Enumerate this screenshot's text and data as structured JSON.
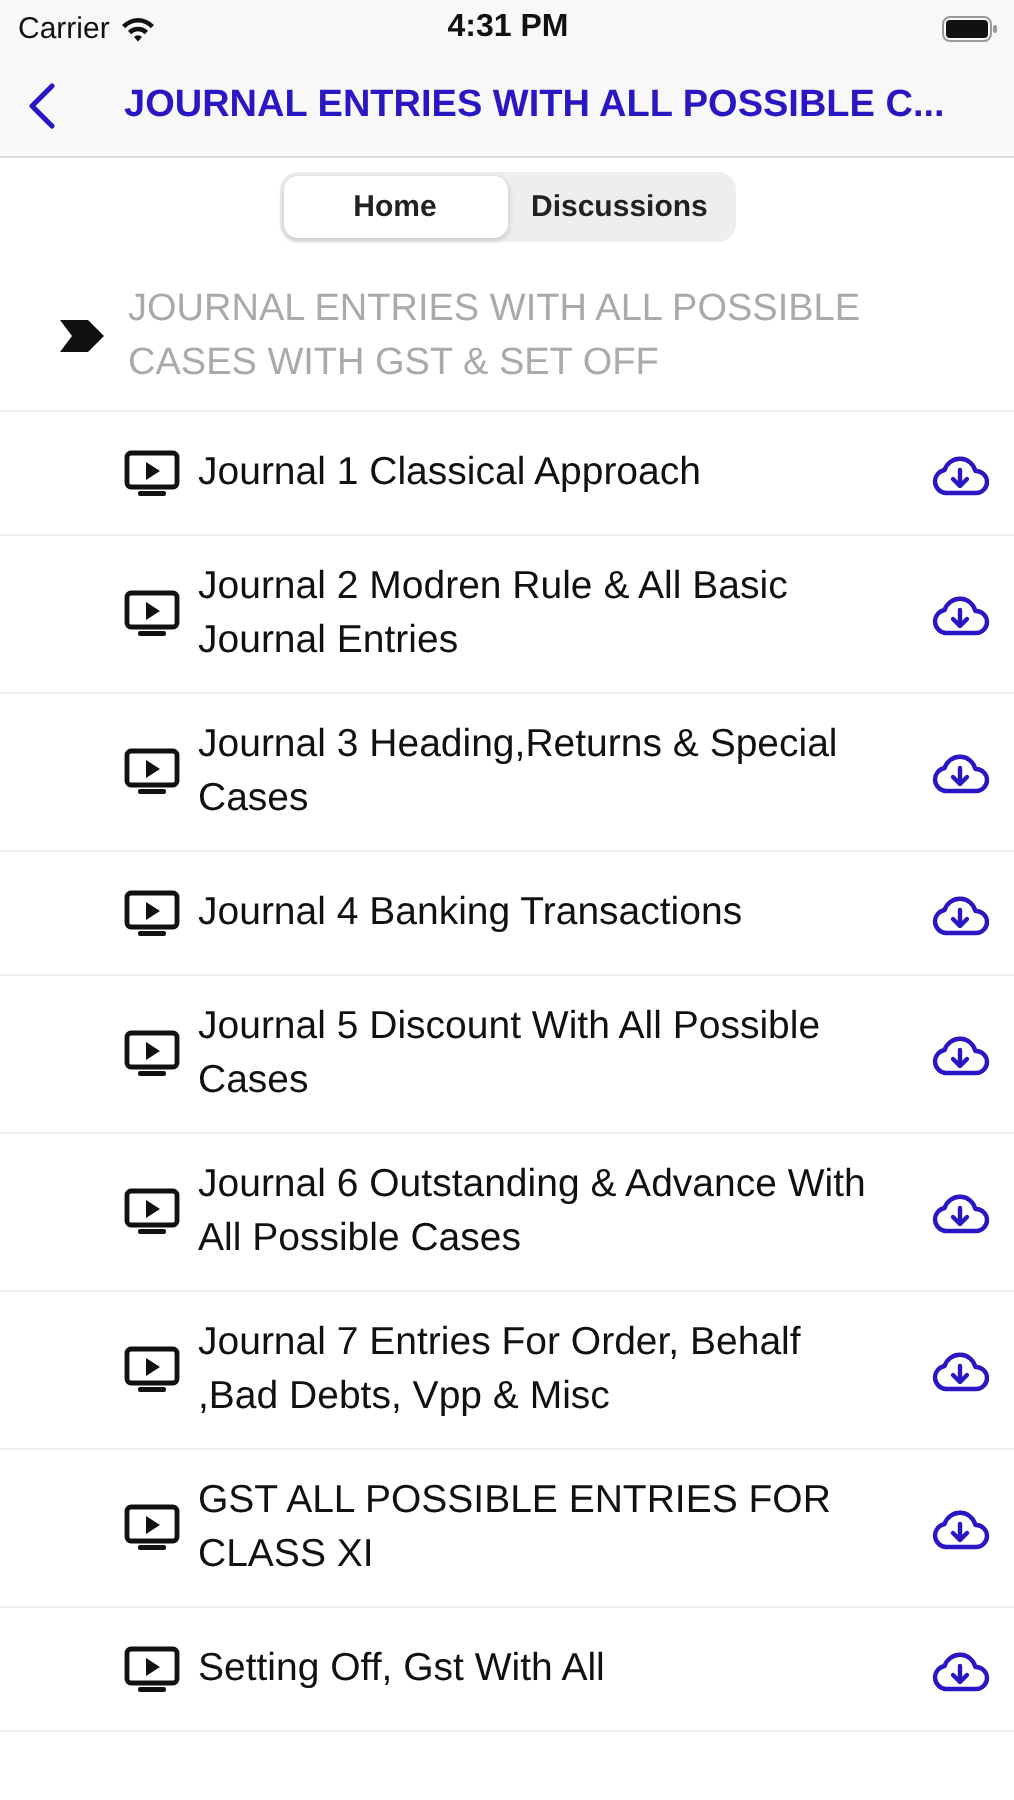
{
  "status_bar": {
    "carrier": "Carrier",
    "time": "4:31 PM"
  },
  "nav": {
    "title": "JOURNAL ENTRIES WITH ALL POSSIBLE C..."
  },
  "segments": [
    {
      "label": "Home",
      "selected": true
    },
    {
      "label": "Discussions",
      "selected": false
    }
  ],
  "section": {
    "title": "JOURNAL ENTRIES WITH ALL POSSIBLE CASES WITH GST & SET OFF"
  },
  "lessons": [
    {
      "title": "Journal 1 Classical Approach"
    },
    {
      "title": "Journal 2 Modren Rule & All Basic Journal Entries"
    },
    {
      "title": "Journal 3 Heading,Returns & Special Cases"
    },
    {
      "title": "Journal 4 Banking Transactions"
    },
    {
      "title": "Journal 5 Discount With All Possible Cases"
    },
    {
      "title": "Journal 6 Outstanding & Advance With All Possible Cases"
    },
    {
      "title": "Journal 7 Entries For Order, Behalf ,Bad Debts, Vpp & Misc"
    },
    {
      "title": "GST ALL POSSIBLE ENTRIES FOR CLASS XI"
    },
    {
      "title": "Setting Off, Gst With All"
    }
  ]
}
